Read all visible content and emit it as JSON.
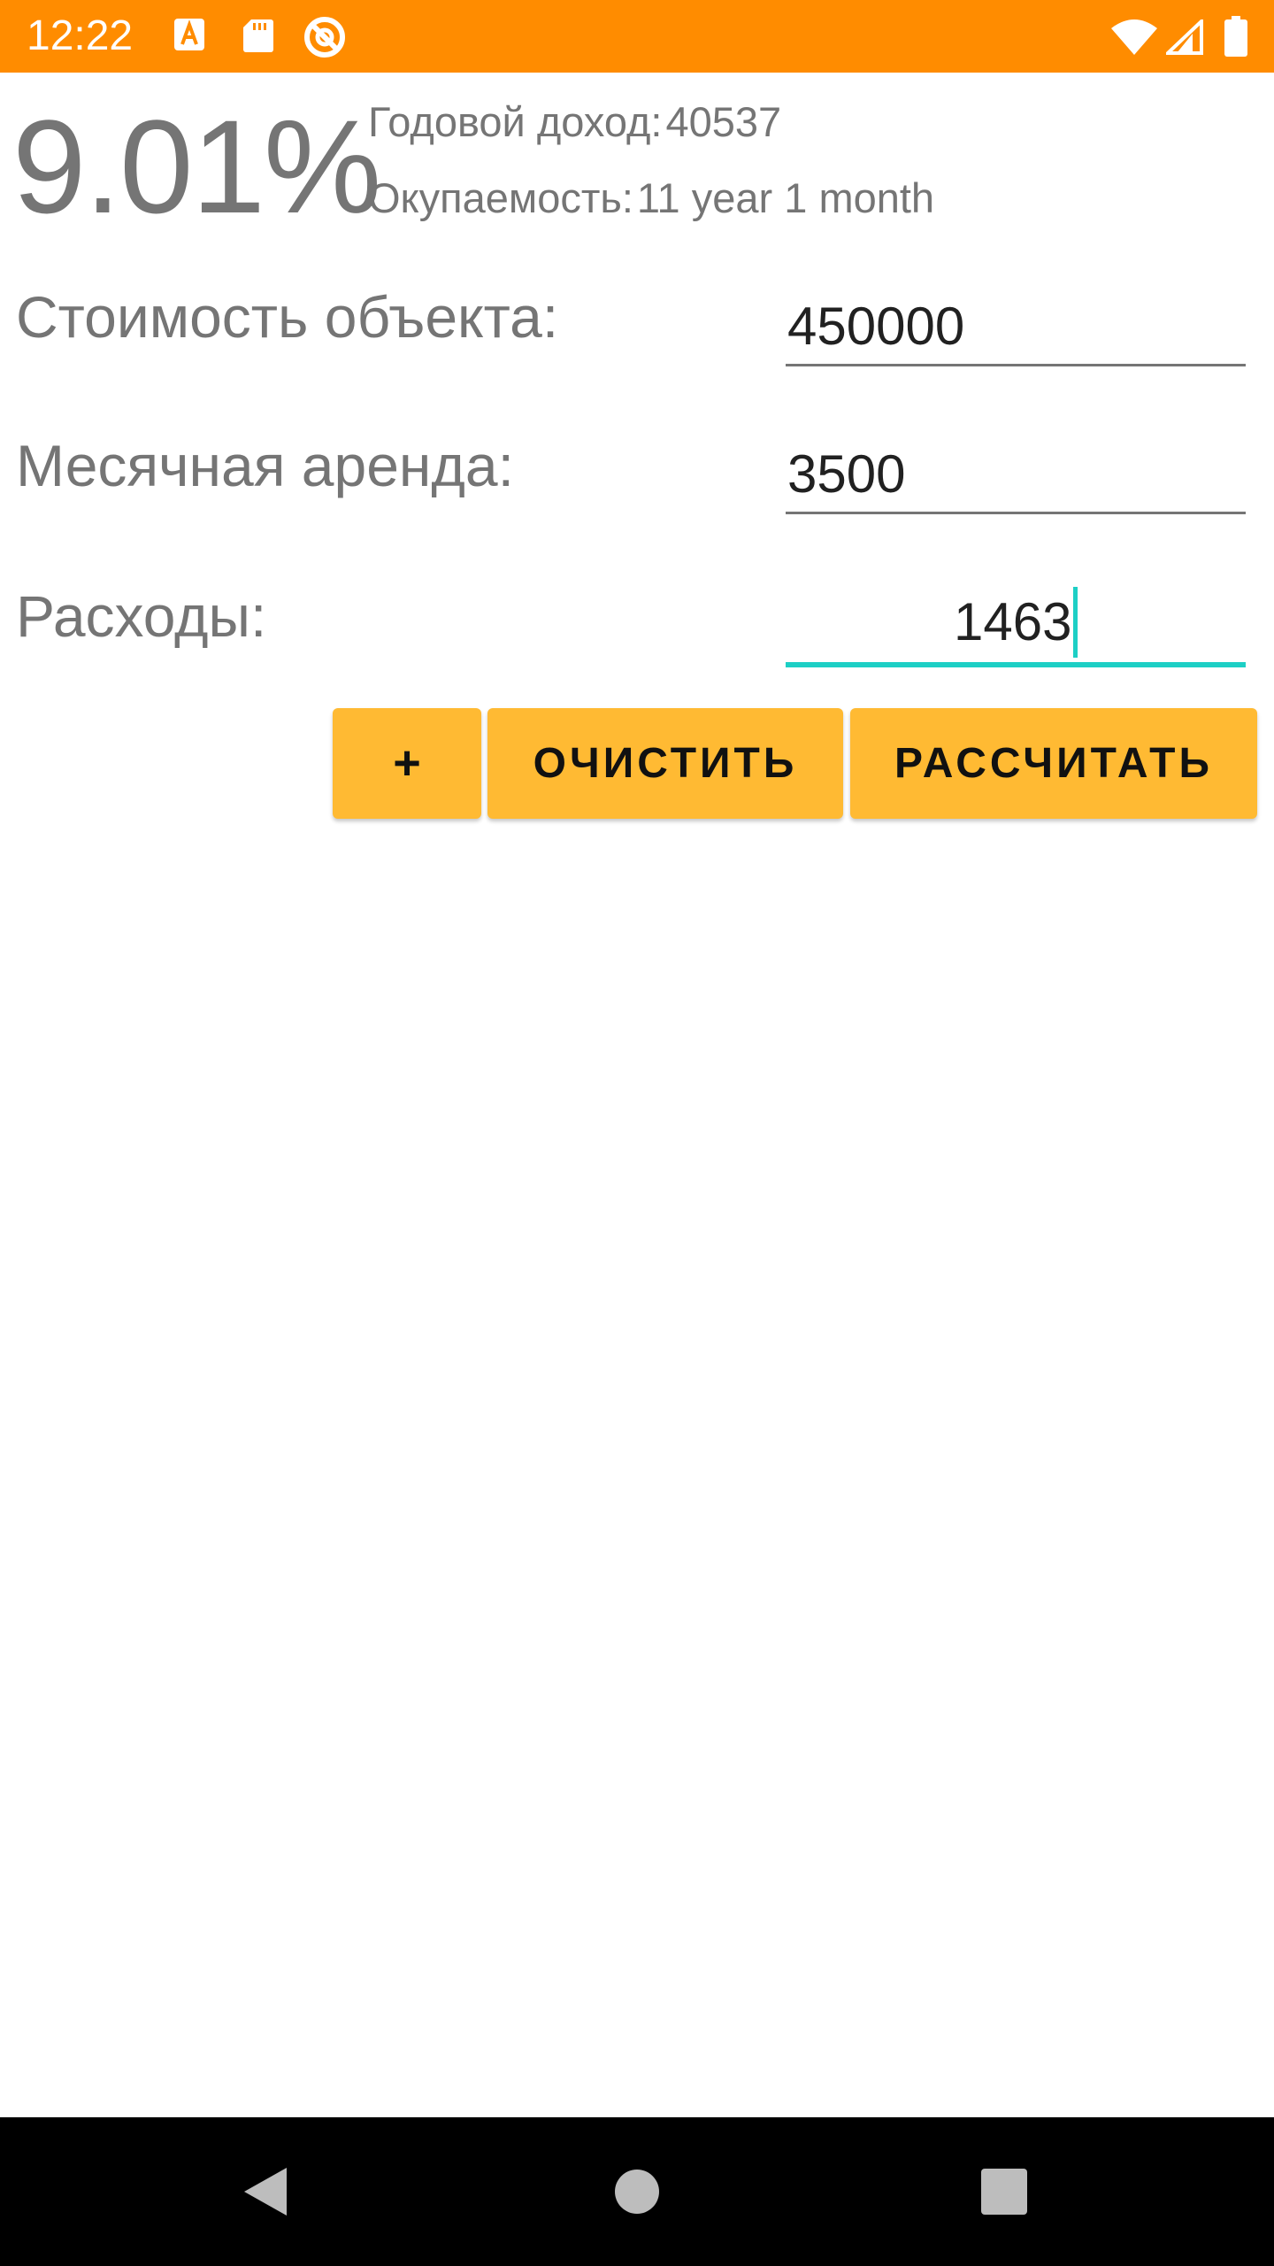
{
  "status_bar": {
    "time": "12:22",
    "background_color": "#FF8C00",
    "icons": [
      "text-a-icon",
      "sd-card-icon",
      "no-disturb-icon",
      "wifi-icon",
      "signal-icon",
      "battery-icon"
    ]
  },
  "results": {
    "yield_percent": "9.01%",
    "annual_income_label": "Годовой доход:",
    "annual_income_value": "40537",
    "payback_label": "Окупаемость:",
    "payback_value": "11 year 1 month"
  },
  "form": {
    "property_cost": {
      "label": "Стоимость объекта:",
      "value": "450000"
    },
    "monthly_rent": {
      "label": "Месячная аренда:",
      "value": "3500"
    },
    "expenses": {
      "label": "Расходы:",
      "value": "1463",
      "focused": true
    }
  },
  "buttons": {
    "plus": "+",
    "clear": "ОЧИСТИТЬ",
    "calculate": "РАССЧИТАТЬ",
    "color": "#FFBA33"
  },
  "colors": {
    "accent": "#1DCFC5",
    "text_secondary": "#757575"
  },
  "nav_bar": {
    "icons": [
      "back-icon",
      "home-icon",
      "recents-icon"
    ]
  }
}
